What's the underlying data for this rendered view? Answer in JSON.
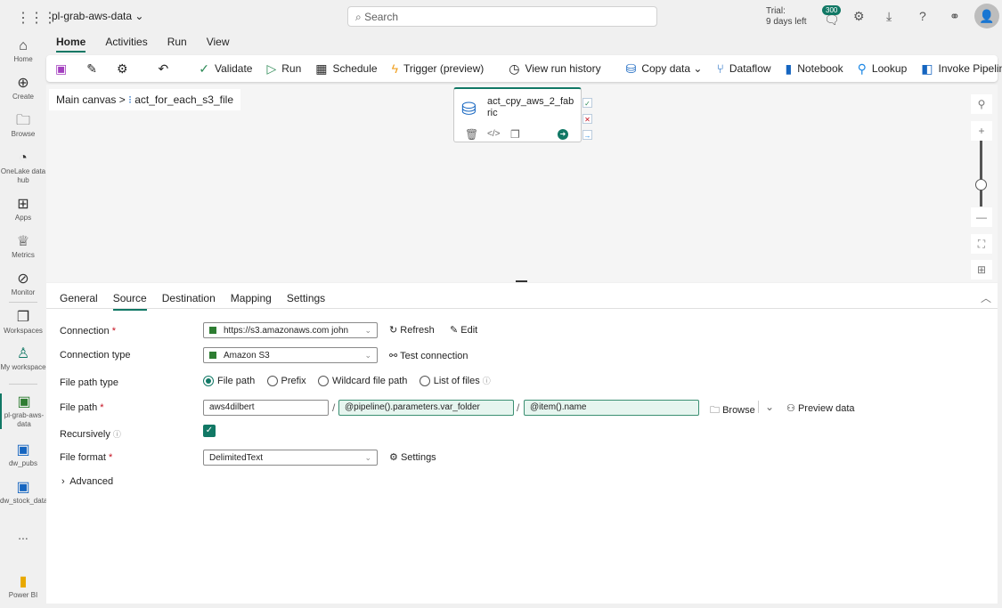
{
  "header": {
    "app_name": "pl-grab-aws-data",
    "search_placeholder": "Search",
    "trial_line1": "Trial:",
    "trial_line2": "9 days left",
    "notification_count": "300"
  },
  "rail": [
    {
      "label": "Home"
    },
    {
      "label": "Create"
    },
    {
      "label": "Browse"
    },
    {
      "label": "OneLake data hub"
    },
    {
      "label": "Apps"
    },
    {
      "label": "Metrics"
    },
    {
      "label": "Monitor"
    },
    {
      "label": "Workspaces"
    },
    {
      "label": "My workspace"
    },
    {
      "label": "pl-grab-aws-data"
    },
    {
      "label": "dw_pubs"
    },
    {
      "label": "dw_stock_data"
    },
    {
      "label": "..."
    },
    {
      "label": "Power BI"
    }
  ],
  "ribbon_tabs": [
    "Home",
    "Activities",
    "Run",
    "View"
  ],
  "toolbar": {
    "validate": "Validate",
    "run": "Run",
    "schedule": "Schedule",
    "trigger": "Trigger (preview)",
    "history": "View run history",
    "copy": "Copy data",
    "dataflow": "Dataflow",
    "notebook": "Notebook",
    "lookup": "Lookup",
    "invoke": "Invoke Pipeline"
  },
  "breadcrumb": {
    "root": "Main canvas",
    "sep": ">",
    "current": "act_for_each_s3_file"
  },
  "activity": {
    "name": "act_cpy_aws_2_fabric"
  },
  "panel_tabs": [
    "General",
    "Source",
    "Destination",
    "Mapping",
    "Settings"
  ],
  "form": {
    "connection_label": "Connection",
    "connection_value": "https://s3.amazonaws.com john",
    "refresh": "Refresh",
    "edit": "Edit",
    "conn_type_label": "Connection type",
    "conn_type_value": "Amazon S3",
    "test": "Test connection",
    "path_type_label": "File path type",
    "path_types": [
      "File path",
      "Prefix",
      "Wildcard file path",
      "List of files"
    ],
    "file_path_label": "File path",
    "bucket": "aws4dilbert",
    "folder": "@pipeline().parameters.var_folder",
    "file": "@item().name",
    "browse": "Browse",
    "preview": "Preview data",
    "recursively_label": "Recursively",
    "format_label": "File format",
    "format_value": "DelimitedText",
    "settings": "Settings",
    "advanced": "Advanced"
  }
}
